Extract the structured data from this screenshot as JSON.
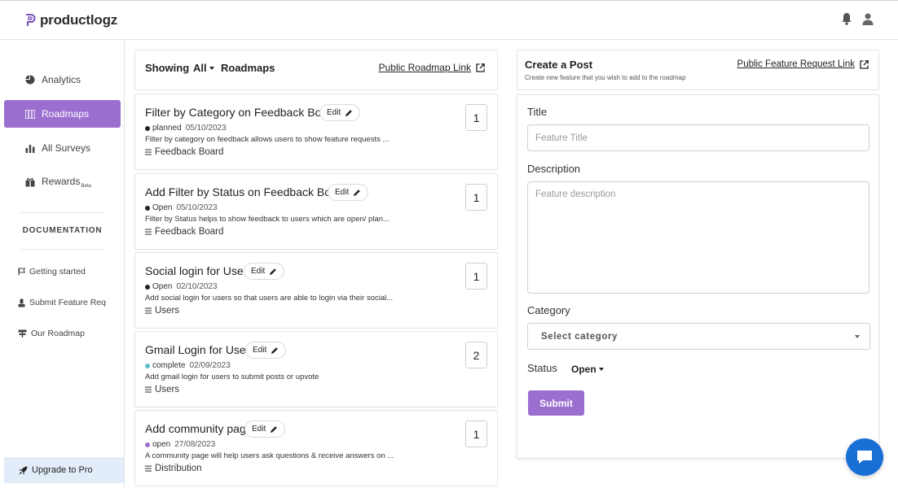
{
  "app": {
    "logo_text": "productlogz"
  },
  "header": {
    "icons": [
      "bell-icon",
      "user-icon"
    ]
  },
  "sidebar": {
    "items": [
      {
        "label": "Analytics",
        "icon": "pie-chart-icon"
      },
      {
        "label": "Roadmaps",
        "icon": "roadmap-icon",
        "active": true
      },
      {
        "label": "All Surveys",
        "icon": "bar-chart-icon"
      },
      {
        "label": "Rewards",
        "badge": "Beta",
        "icon": "gift-icon"
      }
    ],
    "documentation_title": "DOCUMENTATION",
    "doc_links": [
      {
        "label": "Getting started",
        "icon": "flag-icon"
      },
      {
        "label": "Submit Feature Req",
        "icon": "person-icon"
      },
      {
        "label": "Our Roadmap",
        "icon": "signpost-icon"
      }
    ],
    "upgrade_label": "Upgrade to Pro"
  },
  "showing": {
    "label": "Showing",
    "filter_value": "All",
    "roadmaps_label": "Roadmaps",
    "public_link": "Public Roadmap Link"
  },
  "posts": [
    {
      "title": "Filter by Category on Feedback Board",
      "edit": "Edit",
      "status": "planned",
      "status_color": "#222222",
      "date": "05/10/2023",
      "description": "Filter by category on feedback allows users to show feature requests ...",
      "board": "Feedback Board",
      "votes": "1"
    },
    {
      "title": "Add Filter by Status on Feedback Board",
      "edit": "Edit",
      "status": "Open",
      "status_color": "#222222",
      "date": "05/10/2023",
      "description": "Filter by Status helps to show feedback to users which are open/ plan...",
      "board": "Feedback Board",
      "votes": "1"
    },
    {
      "title": "Social login for Users",
      "edit": "Edit",
      "status": "Open",
      "status_color": "#222222",
      "date": "02/10/2023",
      "description": "Add social login for users so that users are able to login via their social...",
      "board": "Users",
      "votes": "1"
    },
    {
      "title": "Gmail Login for Users",
      "edit": "Edit",
      "status": "complete",
      "status_color": "#5bc0c8",
      "date": "02/09/2023",
      "description": "Add gmail login for users to submit posts or upvote",
      "board": "Users",
      "votes": "2"
    },
    {
      "title": "Add community page",
      "edit": "Edit",
      "status": "open",
      "status_color": "#9b6fcf",
      "date": "27/08/2023",
      "description": "A community page will help users ask questions & receive answers on ...",
      "board": "Distribution",
      "votes": "1"
    }
  ],
  "create_post": {
    "title": "Create a Post",
    "subtitle": "Create new feature that you wish to add to the roadmap",
    "request_link": "Public Feature Request Link",
    "title_label": "Title",
    "title_placeholder": "Feature Title",
    "description_label": "Description",
    "description_placeholder": "Feature description",
    "category_label": "Category",
    "category_value": "Select category",
    "status_label": "Status",
    "status_value": "Open",
    "submit_label": "Submit"
  },
  "colors": {
    "accent": "#9b6fcf",
    "chat": "#1a6fd6",
    "upgrade_bg": "#e2edf9"
  }
}
